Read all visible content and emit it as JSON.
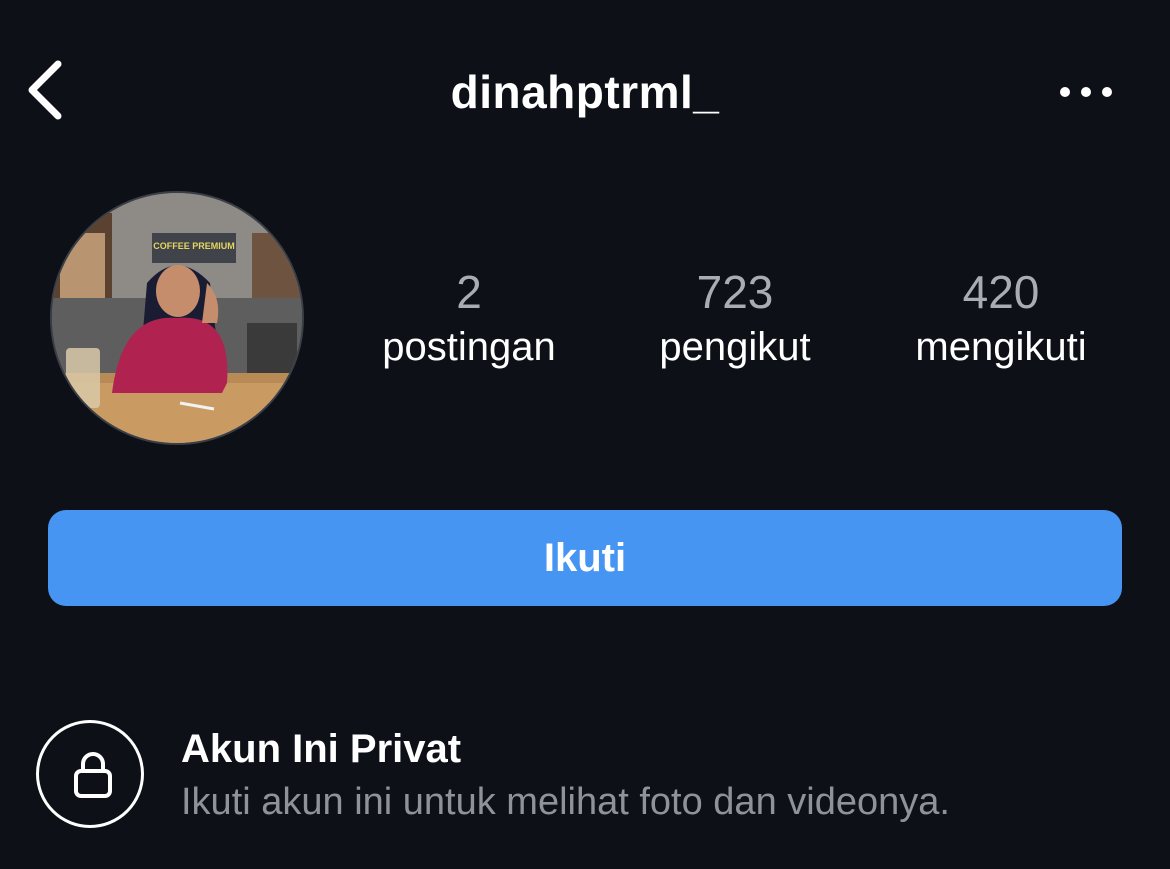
{
  "header": {
    "username": "dinahptrml_",
    "back_icon": "chevron-left-icon",
    "more_icon": "more-horizontal-icon"
  },
  "profile": {
    "avatar_icon": "profile-photo",
    "avatar_sign_text": "COFFEE PREMIUM",
    "stats": {
      "posts": {
        "value": "2",
        "label": "postingan"
      },
      "followers": {
        "value": "723",
        "label": "pengikut"
      },
      "following": {
        "value": "420",
        "label": "mengikuti"
      }
    }
  },
  "actions": {
    "follow_label": "Ikuti"
  },
  "private_notice": {
    "icon": "lock-icon",
    "title": "Akun Ini Privat",
    "description": "Ikuti akun ini untuk melihat foto dan videonya."
  },
  "colors": {
    "background": "#0d1117",
    "primary_button": "#4795f3",
    "muted_text": "#8e939b",
    "stat_number": "#a8acb3"
  }
}
